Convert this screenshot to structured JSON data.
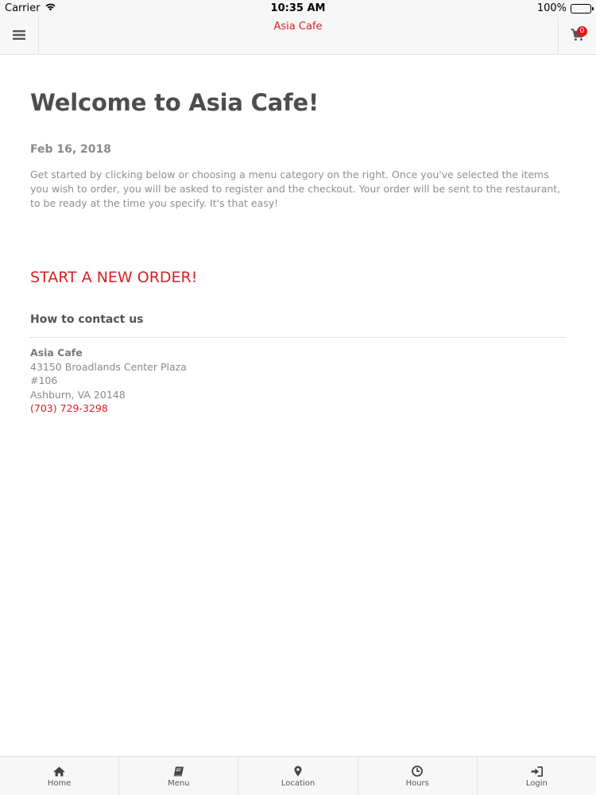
{
  "status_bar": {
    "carrier": "Carrier",
    "time": "10:35 AM",
    "battery": "100%",
    "battery_level": 1.0
  },
  "header": {
    "title": "Asia Cafe",
    "menu_icon": "hamburger-icon",
    "cart_icon": "cart-icon",
    "cart_count": "0"
  },
  "main": {
    "title": "Welcome to Asia Cafe!",
    "date": "Feb 16, 2018",
    "intro": "Get started by clicking below or choosing a menu category on the right. Once you've selected the items you wish to order, you will be asked to register and the checkout. Your order will be sent to the restaurant, to be ready at the time you specify. It's that easy!",
    "cta_label": "START A NEW ORDER!",
    "contact_heading": "How to contact us",
    "contact": {
      "name": "Asia Cafe",
      "address1": "43150 Broadlands Center Plaza",
      "address2": "#106",
      "city_state": "Ashburn, VA 20148",
      "phone": "(703) 729-3298"
    }
  },
  "tabbar": {
    "items": [
      {
        "label": "Home",
        "icon": "home-icon"
      },
      {
        "label": "Menu",
        "icon": "book-icon"
      },
      {
        "label": "Location",
        "icon": "map-pin-icon"
      },
      {
        "label": "Hours",
        "icon": "clock-icon"
      },
      {
        "label": "Login",
        "icon": "login-icon"
      }
    ]
  },
  "colors": {
    "accent": "#d91f26",
    "badge": "#e8131b",
    "bar_background": "#f7f7f7"
  }
}
